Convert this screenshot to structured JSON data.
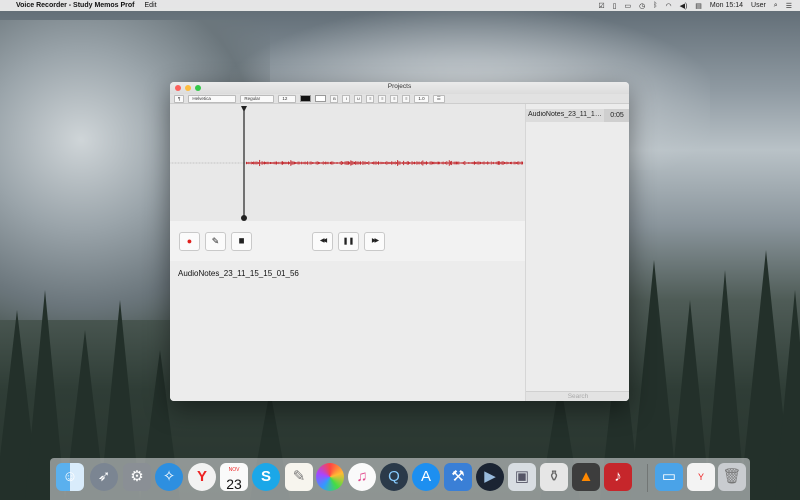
{
  "menubar": {
    "app_name": "Voice Recorder - Study Memos Prof",
    "edit_label": "Edit",
    "clock": "Mon 15:14",
    "user": "User"
  },
  "window": {
    "title": "Projects",
    "format_bar": {
      "paragraph": "¶",
      "font_family": "Helvetica",
      "font_style": "Regular",
      "font_size": "12",
      "bold": "B",
      "italic": "I",
      "underline": "U",
      "line_spacing": "1.0"
    }
  },
  "controls": {
    "record": "●",
    "edit": "✎",
    "open": "▆",
    "rewind": "◀◀",
    "pause": "❚❚",
    "forward": "▶▶"
  },
  "note": {
    "title": "AudioNotes_23_11_15_15_01_56"
  },
  "recordings": [
    {
      "name": "AudioNotes_23_11_15_15_01_56",
      "duration": "0:05"
    }
  ],
  "search": {
    "placeholder": "Search"
  },
  "colors": {
    "waveform": "#c0161c",
    "record": "#e0201c"
  },
  "dock": {
    "items": [
      "finder-icon",
      "launchpad-icon",
      "system-preferences-icon",
      "safari-icon",
      "yandex-browser-icon",
      "calendar-icon",
      "skype-icon",
      "textedit-icon",
      "photos-icon",
      "itunes-icon",
      "quicktime-icon",
      "app-store-icon",
      "xcode-icon",
      "dvd-player-icon",
      "preview-icon",
      "script-editor-icon",
      "garageband-icon",
      "voice-recorder-icon",
      "downloads-folder-icon",
      "yandex-window-icon",
      "trash-icon"
    ],
    "calendar_month": "NOV",
    "calendar_day": "23"
  }
}
